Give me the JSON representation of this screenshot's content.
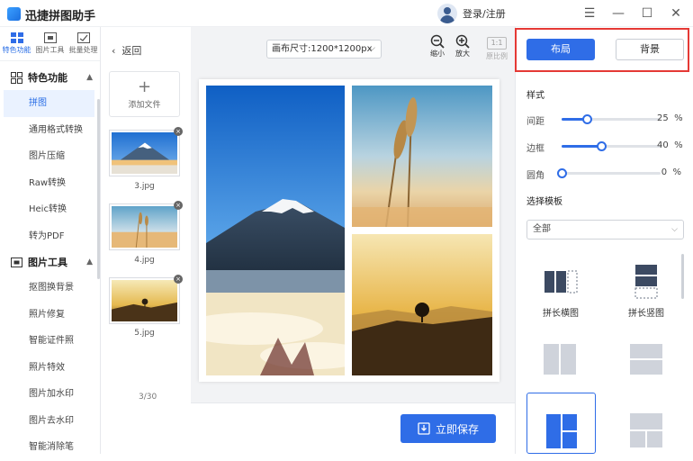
{
  "app": {
    "title": "迅捷拼图助手",
    "login": "登录/注册"
  },
  "window": {
    "menu": "☰",
    "minimize": "—",
    "maximize": "☐",
    "close": "✕"
  },
  "sidebar": {
    "tabs": [
      {
        "label": "特色功能"
      },
      {
        "label": "图片工具"
      },
      {
        "label": "批量处理"
      }
    ],
    "sections": [
      {
        "title": "特色功能",
        "items": [
          "拼图",
          "通用格式转换",
          "图片压缩",
          "Raw转换",
          "Heic转换",
          "转为PDF"
        ]
      },
      {
        "title": "图片工具",
        "items": [
          "抠图换背景",
          "照片修复",
          "智能证件照",
          "照片特效",
          "图片加水印",
          "图片去水印",
          "智能消除笔"
        ]
      }
    ]
  },
  "files": {
    "back": "返回",
    "add": "添加文件",
    "items": [
      {
        "name": "3.jpg"
      },
      {
        "name": "4.jpg"
      },
      {
        "name": "5.jpg"
      }
    ],
    "count": "3/30"
  },
  "toolbar": {
    "canvas_size": "画布尺寸:1200*1200px",
    "zoom_out": "缩小",
    "zoom_in": "放大",
    "ratio_box": "1:1",
    "original_ratio": "原比例"
  },
  "save": {
    "label": "立即保存"
  },
  "panel": {
    "tabs": {
      "layout": "布局",
      "background": "背景"
    },
    "style_title": "样式",
    "sliders": [
      {
        "label": "间距",
        "value": 25,
        "unit": "%"
      },
      {
        "label": "边框",
        "value": 40,
        "unit": "%"
      },
      {
        "label": "圆角",
        "value": 0,
        "unit": "%"
      }
    ],
    "template_title": "选择模板",
    "template_filter": "全部",
    "templates": [
      {
        "label": "拼长横图"
      },
      {
        "label": "拼长竖图"
      }
    ]
  },
  "colors": {
    "accent": "#2f6de7",
    "highlight": "#e53935"
  }
}
